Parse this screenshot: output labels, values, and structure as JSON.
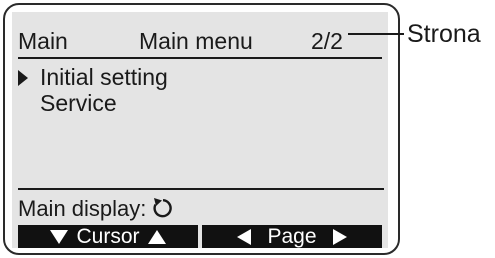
{
  "header": {
    "left_label": "Main",
    "title": "Main menu",
    "page_indicator": "2/2"
  },
  "menu": {
    "items": [
      {
        "label": "Initial setting",
        "selected": true
      },
      {
        "label": "Service",
        "selected": false
      }
    ]
  },
  "footer": {
    "main_display_label": "Main display:",
    "main_display_icon": "return-arrow-icon"
  },
  "softkeys": {
    "cursor_label": "Cursor",
    "page_label": "Page"
  },
  "annotation": {
    "label": "Strona"
  }
}
